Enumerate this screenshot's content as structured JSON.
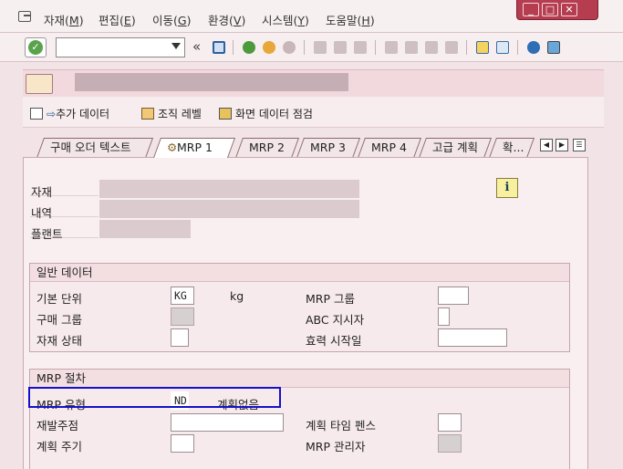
{
  "menu": {
    "items": [
      {
        "label": "자재",
        "mnemonic": "M"
      },
      {
        "label": "편집",
        "mnemonic": "E"
      },
      {
        "label": "이동",
        "mnemonic": "G"
      },
      {
        "label": "환경",
        "mnemonic": "V"
      },
      {
        "label": "시스템",
        "mnemonic": "Y"
      },
      {
        "label": "도움말",
        "mnemonic": "H"
      }
    ]
  },
  "window": {
    "minimize": "_",
    "maximize": "□",
    "close": "✕"
  },
  "toolbar": {
    "command_value": "",
    "back_chevrons": "«"
  },
  "app_toolbar": {
    "additional_data": "추가 데이터",
    "org_levels": "조직 레벨",
    "check_screen_data": "화면 데이터 점검"
  },
  "tabs": [
    "구매 오더 텍스트",
    "MRP 1",
    "MRP 2",
    "MRP 3",
    "MRP 4",
    "고급 계획",
    "확..."
  ],
  "header": {
    "material_label": "자재",
    "description_label": "내역",
    "plant_label": "플랜트",
    "info_icon": "i"
  },
  "general": {
    "title": "일반 데이터",
    "base_unit_label": "기본 단위",
    "base_unit_value": "KG",
    "base_unit_text": "kg",
    "purchasing_group_label": "구매 그룹",
    "material_status_label": "자재 상태",
    "mrp_group_label": "MRP 그룹",
    "abc_label": "ABC 지시자",
    "valid_from_label": "효력 시작일"
  },
  "mrp": {
    "title": "MRP 절차",
    "mrp_type_label": "MRP 유형",
    "mrp_type_value": "ND",
    "mrp_type_text": "계획없음",
    "reorder_label": "재발주점",
    "planning_cycle_label": "계획 주기",
    "time_fence_label": "계획 타임 펜스",
    "controller_label": "MRP 관리자"
  }
}
